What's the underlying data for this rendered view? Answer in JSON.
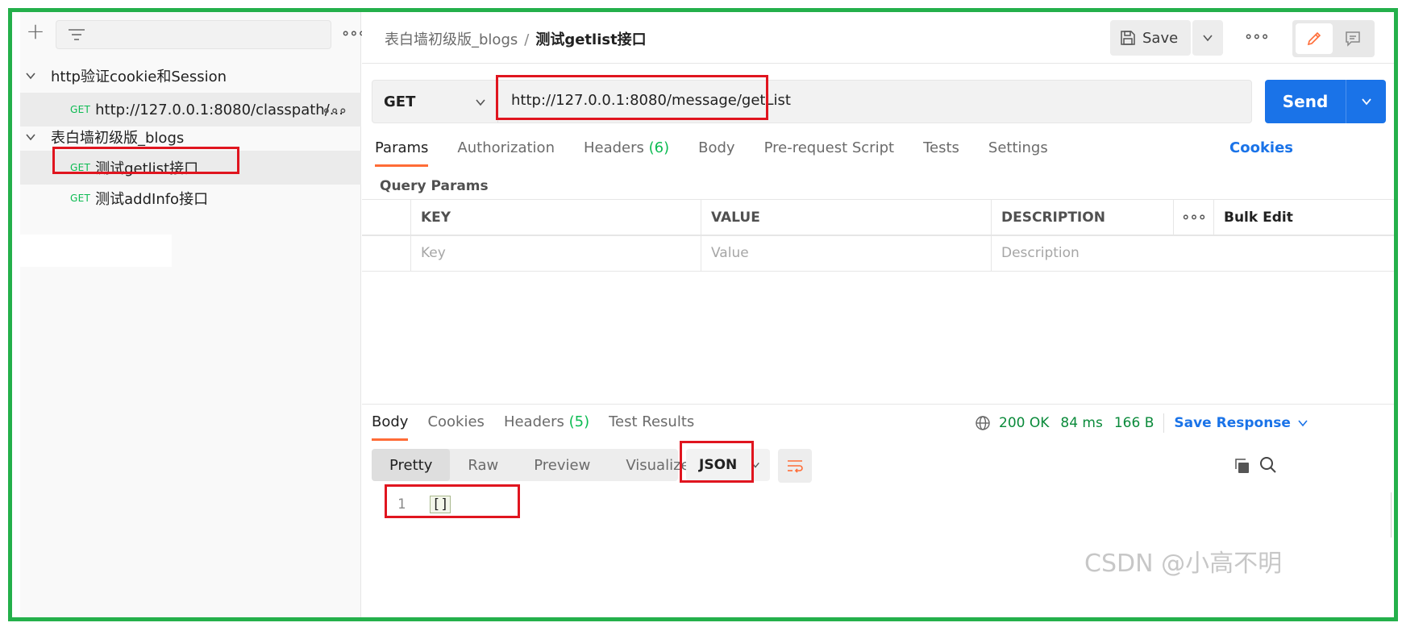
{
  "sidebar": {
    "collections": [
      {
        "name": "http验证cookie和Session",
        "requests": [
          {
            "method": "GET",
            "name": "http://127.0.0.1:8080/classpath/..."
          }
        ]
      },
      {
        "name": "表白墙初级版_blogs",
        "requests": [
          {
            "method": "GET",
            "name": "测试getlist接口"
          },
          {
            "method": "GET",
            "name": "测试addInfo接口"
          }
        ]
      }
    ]
  },
  "header": {
    "breadcrumb_parent": "表白墙初级版_blogs",
    "breadcrumb_sep": "/",
    "breadcrumb_current": "测试getlist接口",
    "save_label": "Save"
  },
  "request": {
    "method": "GET",
    "url": "http://127.0.0.1:8080/message/getList",
    "send_label": "Send",
    "tabs": [
      {
        "label": "Params",
        "count": ""
      },
      {
        "label": "Authorization",
        "count": ""
      },
      {
        "label": "Headers",
        "count": "(6)"
      },
      {
        "label": "Body",
        "count": ""
      },
      {
        "label": "Pre-request Script",
        "count": ""
      },
      {
        "label": "Tests",
        "count": ""
      },
      {
        "label": "Settings",
        "count": ""
      }
    ],
    "cookies_label": "Cookies",
    "query_params_label": "Query Params",
    "params_table": {
      "headers": {
        "key": "KEY",
        "value": "VALUE",
        "description": "DESCRIPTION",
        "bulk_edit": "Bulk Edit"
      },
      "placeholders": {
        "key": "Key",
        "value": "Value",
        "description": "Description"
      }
    }
  },
  "response": {
    "tabs": [
      {
        "label": "Body",
        "count": ""
      },
      {
        "label": "Cookies",
        "count": ""
      },
      {
        "label": "Headers",
        "count": "(5)"
      },
      {
        "label": "Test Results",
        "count": ""
      }
    ],
    "status": "200 OK",
    "time": "84 ms",
    "size": "166 B",
    "save_response_label": "Save Response",
    "view_modes": [
      "Pretty",
      "Raw",
      "Preview",
      "Visualize"
    ],
    "format": "JSON",
    "body_lines": [
      {
        "line": "1",
        "text": "[]"
      }
    ]
  },
  "watermark": "CSDN @小高不明",
  "colors": {
    "frame_border": "#24b04b",
    "annotation_red": "#e0151f",
    "accent_blue": "#1a73e8",
    "tab_underline": "#ff6c37",
    "method_green": "#0cbb52"
  }
}
